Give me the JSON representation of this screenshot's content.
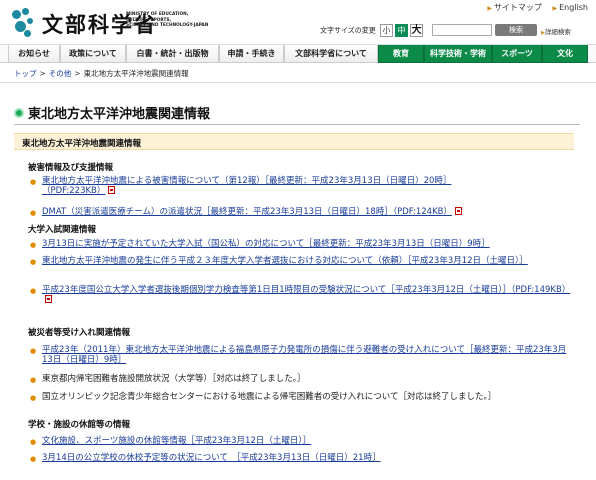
{
  "header": {
    "logo_jp": "文部科学省",
    "logo_en": [
      "MINISTRY OF EDUCATION,",
      "CULTURE, SPORTS,",
      "SCIENCE AND TECHNOLOGY-JAPAN"
    ],
    "util_links": [
      "サイトマップ",
      "English"
    ],
    "font_size_label": "文字サイズの変更",
    "font_sizes": [
      "小",
      "中",
      "大"
    ],
    "search_placeholder": "",
    "search_button": "検索",
    "advanced_search": "詳細検索"
  },
  "nav": [
    "お知らせ",
    "政策について",
    "白書・統計・出版物",
    "申請・手続き",
    "文部科学省について",
    "教育",
    "科学技術・学術",
    "スポーツ",
    "文化"
  ],
  "breadcrumb": [
    "トップ",
    "その他",
    "東北地方太平洋沖地震関連情報"
  ],
  "page_title": "東北地方太平洋沖地震関連情報",
  "section_bar": "東北地方太平洋沖地震関連情報",
  "groups": [
    {
      "heading": "被害情報及び支援情報",
      "items": [
        "東北地方太平洋沖地震による被害情報について（第12報）［最終更新：平成23年3月13日（日曜日）20時］",
        "（PDF:223KB）",
        "DMAT（災害派遣医療チーム）の派遣状況［最終更新：平成23年3月13日（日曜日）18時］（PDF:124KB）"
      ]
    },
    {
      "heading": "大学入試関連情報",
      "items": [
        "3月13日に実施が予定されていた大学入試（国公私）の対応について［最終更新：平成23年3月13日（日曜日）9時］",
        "東北地方太平洋沖地震の発生に伴う平成２３年度大学入学者選抜における対応について（依頼）［平成23年3月12日（土曜日）］",
        "平成23年度国公立大学入学者選抜後期個別学力検査等第1日目1時限目の受験状況について［平成23年3月12日（土曜日）］（PDF:149KB）"
      ]
    },
    {
      "heading": "被災者等受け入れ関連情報",
      "items": [
        "平成23年（2011年）東北地方太平洋沖地震による福島県原子力発電所の損傷に伴う避難者の受け入れについて［最終更新：平成23年3月13日（日曜日）9時］",
        "東京都内帰宅困難者施設開放状況（大学等）［対応は終了しました。］",
        "国立オリンピック記念青少年総合センターにおける地震による帰宅困難者の受け入れについて［対応は終了しました。］"
      ]
    },
    {
      "heading": "学校・施設の休館等の情報",
      "items": [
        "文化施設、スポーツ施設の休館等情報［平成23年3月12日（土曜日）］",
        "3月14日の公立学校の休校予定等の状況について　［平成23年3月13日（日曜日）21時］"
      ]
    }
  ]
}
